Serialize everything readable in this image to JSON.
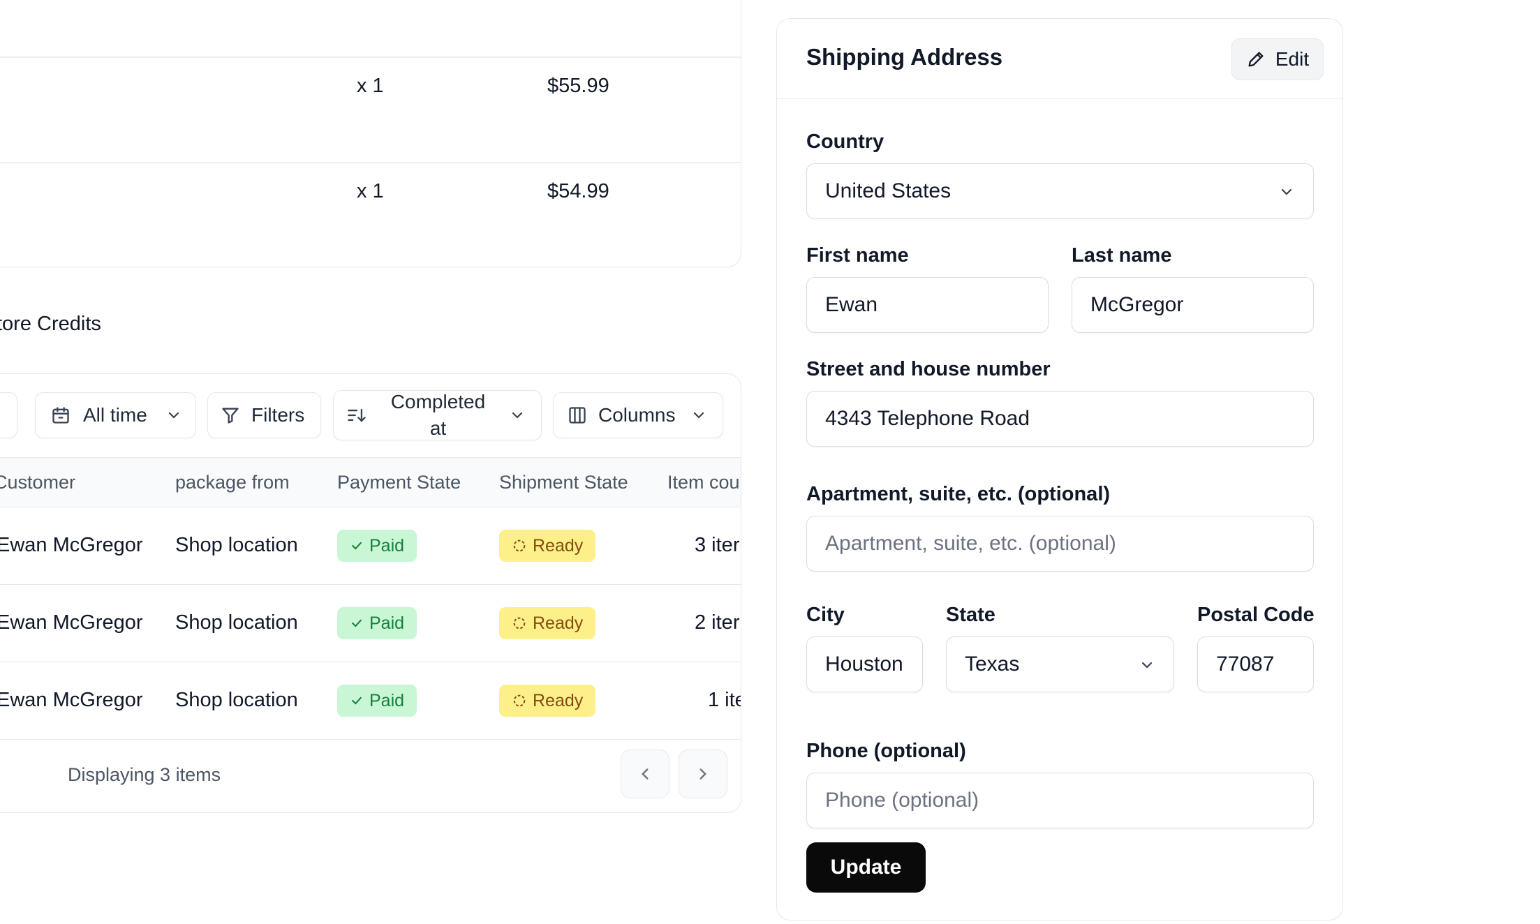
{
  "order_items": [
    {
      "quantity": "x 1",
      "price": "$55.99"
    },
    {
      "quantity": "x 1",
      "price": "$54.99"
    }
  ],
  "store_credits": {
    "section_title": "tore Credits"
  },
  "orders_table": {
    "toolbar": {
      "date_filter": "All time",
      "filters": "Filters",
      "sort_line1": "Completed",
      "sort_line2": "at",
      "columns": "Columns"
    },
    "columns": [
      "Customer",
      "package from",
      "Payment State",
      "Shipment State",
      "Item cou"
    ],
    "rows": [
      {
        "customer": "Ewan McGregor",
        "package_from": "Shop location",
        "payment_state": "Paid",
        "shipment_state": "Ready",
        "item_count": "3 iter"
      },
      {
        "customer": "Ewan McGregor",
        "package_from": "Shop location",
        "payment_state": "Paid",
        "shipment_state": "Ready",
        "item_count": "2 iter"
      },
      {
        "customer": "Ewan McGregor",
        "package_from": "Shop location",
        "payment_state": "Paid",
        "shipment_state": "Ready",
        "item_count": "1 ite"
      }
    ],
    "footer": {
      "display_text": "Displaying 3 items"
    }
  },
  "shipping": {
    "title": "Shipping Address",
    "edit_label": "Edit",
    "country_label": "Country",
    "country_value": "United States",
    "first_name_label": "First name",
    "first_name_value": "Ewan",
    "last_name_label": "Last name",
    "last_name_value": "McGregor",
    "street_label": "Street and house number",
    "street_value": "4343 Telephone Road",
    "apartment_label": "Apartment, suite, etc. (optional)",
    "apartment_placeholder": "Apartment, suite, etc. (optional)",
    "city_label": "City",
    "city_value": "Houston",
    "state_label": "State",
    "state_value": "Texas",
    "postal_label": "Postal Code",
    "postal_value": "77087",
    "phone_label": "Phone (optional)",
    "phone_placeholder": "Phone (optional)",
    "update_label": "Update"
  },
  "colors": {
    "paid_bg": "#c9f7d6",
    "paid_text": "#15803d",
    "ready_bg": "#fdf08a",
    "ready_text": "#854d0e",
    "primary_button": "#0a0a0a"
  }
}
